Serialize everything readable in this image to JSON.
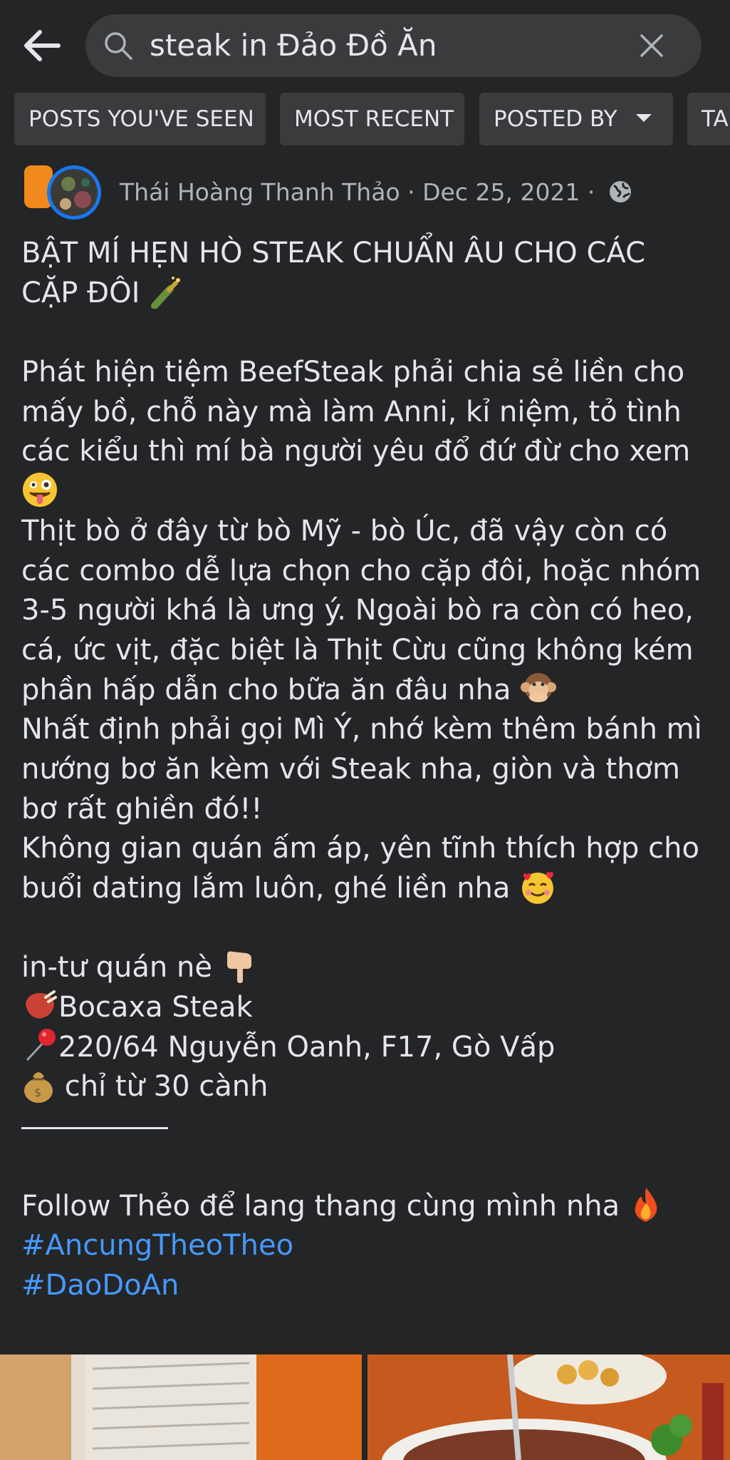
{
  "search": {
    "query": "steak in Đảo Đồ Ăn"
  },
  "filters": [
    {
      "label": "POSTS YOU'VE SEEN"
    },
    {
      "label": "MOST RECENT"
    },
    {
      "label": "POSTED BY"
    },
    {
      "label": "TA"
    }
  ],
  "post": {
    "author": "Thái Hoàng Thanh Thảo",
    "date": "Dec 25, 2021",
    "separator": " · ",
    "lines": {
      "l1": "BẬT MÍ HẸN HÒ STEAK CHUẨN ÂU CHO CÁC",
      "l2": "CẶP ĐÔI",
      "l3": "Phát hiện tiệm BeefSteak phải chia sẻ liền cho",
      "l4": "mấy bồ, chỗ này mà làm Anni, kỉ niệm, tỏ tình",
      "l5": "các kiểu thì mí bà người yêu đổ đứ đừ cho xem",
      "l7": "Thịt bò ở đây từ bò Mỹ - bò Úc, đã vậy còn có",
      "l8": "các combo dễ lựa chọn cho cặp đôi, hoặc nhóm",
      "l9": "3-5 người khá là ưng ý. Ngoài bò ra còn có heo,",
      "l10": "cá, ức vịt, đặc biệt là Thịt Cừu cũng không kém",
      "l11": "phần hấp dẫn cho bữa ăn đâu nha",
      "l12": "Nhất định phải gọi Mì Ý, nhớ kèm thêm bánh mì",
      "l13": "nướng bơ ăn kèm với Steak nha, giòn và thơm",
      "l14": "bơ rất ghiền đó!!",
      "l15": "Không gian quán ấm áp, yên tĩnh thích hợp cho",
      "l16": "buổi dating lắm luôn, ghé liền nha",
      "l17": "in-tư quán nè",
      "l18": "Bocaxa Steak",
      "l19": "220/64 Nguyễn Oanh, F17, Gò Vấp",
      "l20": " chỉ từ 30 cành",
      "l21": "Follow Thẻo để lang thang cùng mình nha",
      "tag1": "#AncungTheoTheo",
      "tag2": "#DaoDoAn"
    }
  },
  "icons": {
    "back": "arrow-left-icon",
    "search": "search-icon",
    "clear": "close-icon",
    "globe": "globe-icon",
    "caret": "caret-down-icon"
  },
  "colors": {
    "background": "#242526",
    "chip": "#3a3b3c",
    "text": "#e4e6eb",
    "muted": "#b0b3b8",
    "hashtag": "#4599ff"
  }
}
